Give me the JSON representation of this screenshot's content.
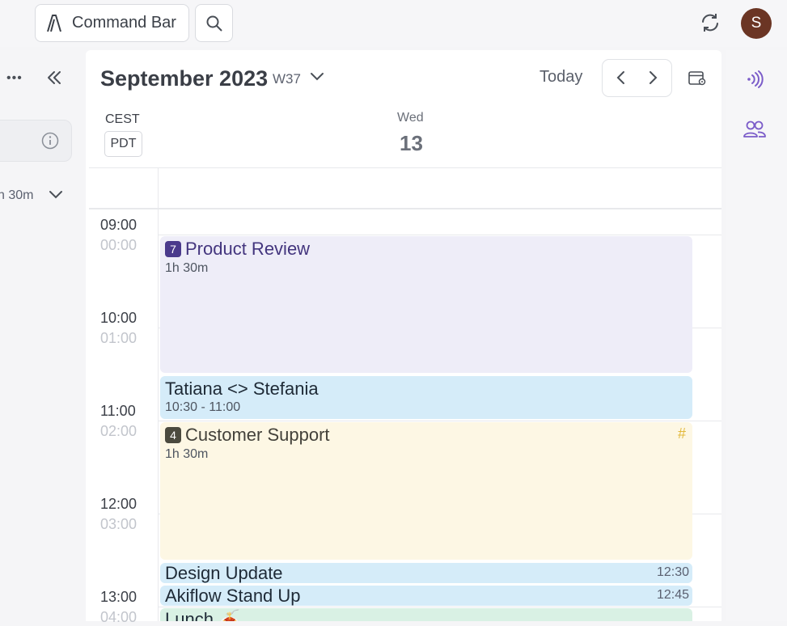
{
  "topbar": {
    "command_bar_label": "Command Bar",
    "avatar_initial": "S"
  },
  "left_panel": {
    "duration_text": "h 30m"
  },
  "header": {
    "month_title": "September 2023",
    "week_label": "W37",
    "today_label": "Today"
  },
  "timezones": {
    "primary": "CEST",
    "secondary": "PDT"
  },
  "day": {
    "name": "Wed",
    "number": "13"
  },
  "time_labels": [
    {
      "main": "09:00",
      "sub": "00:00"
    },
    {
      "main": "10:00",
      "sub": "01:00"
    },
    {
      "main": "11:00",
      "sub": "02:00"
    },
    {
      "main": "12:00",
      "sub": "03:00"
    },
    {
      "main": "13:00",
      "sub": "04:00"
    }
  ],
  "events": [
    {
      "title": "Product Review",
      "badge": "7",
      "sub": "1h 30m",
      "time": "",
      "bg": "#eeedf8",
      "badge_color": "#4a3a8c",
      "title_color": "#43357e"
    },
    {
      "title": "Tatiana <> Stefania",
      "badge": "",
      "sub": "10:30 - 11:00",
      "time": "",
      "bg": "#d5ecf9",
      "badge_color": "",
      "title_color": "#1e2a36"
    },
    {
      "title": "Customer Support",
      "badge": "4",
      "sub": "1h 30m",
      "time": "",
      "hash": "#",
      "bg": "#fdf7e4",
      "badge_color": "#4b4a3e",
      "title_color": "#43413a"
    },
    {
      "title": "Design Update",
      "badge": "",
      "sub": "",
      "time": "12:30",
      "bg": "#d5ecf9",
      "badge_color": "",
      "title_color": "#1e2a36"
    },
    {
      "title": "Akiflow Stand Up",
      "badge": "",
      "sub": "",
      "time": "12:45",
      "bg": "#d5ecf9",
      "badge_color": "",
      "title_color": "#1e2a36"
    },
    {
      "title": "Lunch 🍝",
      "badge": "",
      "sub": "",
      "time": "",
      "bg": "#d9f1e4",
      "badge_color": "",
      "title_color": "#1e2a36"
    }
  ],
  "colors": {
    "accent_purple": "#7b5cc9",
    "avatar_bg": "#6b3524"
  },
  "icons": {
    "command_bar": "akiflow-logo-icon",
    "search": "search-icon",
    "sync": "sync-icon",
    "more": "more-icon",
    "collapse": "collapse-left-icon",
    "info": "info-icon",
    "chevron": "chevron-down-icon",
    "prev": "chevron-left-icon",
    "next": "chevron-right-icon",
    "calendar_settings": "calendar-settings-icon",
    "radio": "broadcast-icon",
    "people": "people-icon"
  }
}
